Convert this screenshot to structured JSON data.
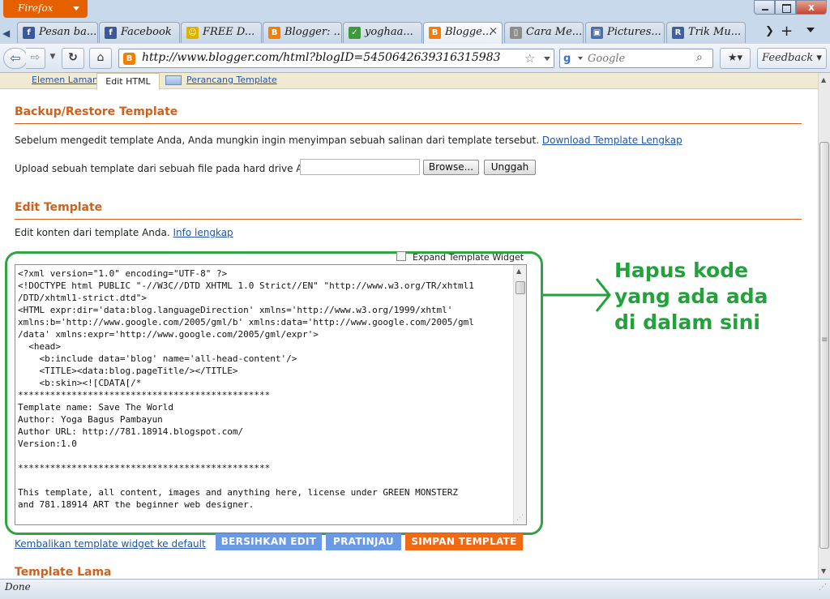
{
  "browser": {
    "app_button": "Firefox",
    "window_close": "x",
    "tabs": [
      {
        "label": "Pesan ba...",
        "icon": "f",
        "color": "#3b5998"
      },
      {
        "label": "Facebook",
        "icon": "f",
        "color": "#3b5998"
      },
      {
        "label": "FREE D...",
        "icon": "☺",
        "color": "#e0b000"
      },
      {
        "label": "Blogger: ...",
        "icon": "B",
        "color": "#f57d00"
      },
      {
        "label": "yoghaa...",
        "icon": "✓",
        "color": "#3c9a3c"
      },
      {
        "label": "Blogge...",
        "icon": "B",
        "color": "#f57d00"
      },
      {
        "label": "Cara Me...",
        "icon": "▯",
        "color": "#8c8c8c"
      },
      {
        "label": "Pictures...",
        "icon": "▣",
        "color": "#4a6fb0"
      },
      {
        "label": "Trik Mu...",
        "icon": "R",
        "color": "#3d5fa6"
      }
    ],
    "url": "http://www.blogger.com/html?blogID=5450642639316315983",
    "search_placeholder": "Google",
    "search_engine_icon": "g",
    "feedback_label": "Feedback",
    "status": "Done"
  },
  "page": {
    "tabs": {
      "layout_elements": "Elemen Laman",
      "edit_html": "Edit HTML",
      "template_designer": "Perancang Template"
    },
    "backup": {
      "title": "Backup/Restore Template",
      "description": "Sebelum mengedit template Anda, Anda mungkin ingin menyimpan sebuah salinan dari template tersebut.",
      "download_link": "Download Template Lengkap",
      "upload_label": "Upload sebuah template dari sebuah file pada hard drive Anda:",
      "browse_label": "Browse...",
      "upload_button": "Unggah"
    },
    "edit": {
      "title": "Edit Template",
      "description": "Edit konten dari template Anda.",
      "info_link": "Info lengkap",
      "expand_widget_label": "Expand Template Widget",
      "code": "<?xml version=\"1.0\" encoding=\"UTF-8\" ?>\n<!DOCTYPE html PUBLIC \"-//W3C//DTD XHTML 1.0 Strict//EN\" \"http://www.w3.org/TR/xhtml1\n/DTD/xhtml1-strict.dtd\">\n<HTML expr:dir='data:blog.languageDirection' xmlns='http://www.w3.org/1999/xhtml'\nxmlns:b='http://www.google.com/2005/gml/b' xmlns:data='http://www.google.com/2005/gml\n/data' xmlns:expr='http://www.google.com/2005/gml/expr'>\n  <head>\n    <b:include data='blog' name='all-head-content'/>\n    <TITLE><data:blog.pageTitle/></TITLE>\n    <b:skin><![CDATA[/*\n***********************************************\nTemplate name: Save The World\nAuthor: Yoga Bagus Pambayun\nAuthor URL: http://781.18914.blogspot.com/\nVersion:1.0\n\n***********************************************\n\nThis template, all content, images and anything here, license under GREEN MONSTERZ\nand 781.18914 ART the beginner web designer.",
      "reset_link": "Kembalikan template widget ke default",
      "clear_button": "BERSIHKAN EDIT",
      "preview_button": "PRATINJAU",
      "save_button": "SIMPAN TEMPLATE"
    },
    "old_template_title": "Template Lama"
  },
  "annotation": {
    "text": "Hapus kode yang ada ada di dalam sini",
    "color": "#22a23a"
  }
}
